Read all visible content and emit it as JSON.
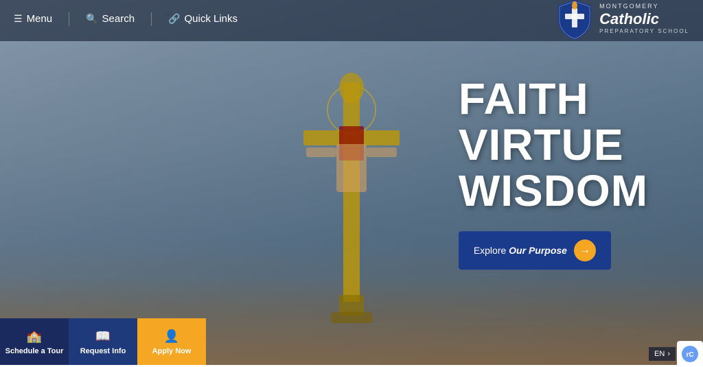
{
  "nav": {
    "menu_label": "Menu",
    "search_label": "Search",
    "quicklinks_label": "Quick Links",
    "logo_montgomery": "MONTGOMERY",
    "logo_catholic": "Catholic",
    "logo_prep": "PREPARATORY SCHOOL"
  },
  "hero": {
    "line1": "FAITH",
    "line2": "VIRTUE",
    "line3": "WISDOM",
    "cta_label": "Explore ",
    "cta_emphasis": "Our Purpose",
    "cta_arrow": "→"
  },
  "actions": [
    {
      "id": "schedule-tour",
      "label": "Schedule a Tour",
      "icon": "🏫"
    },
    {
      "id": "request-info",
      "label": "Request Info",
      "icon": "📖"
    },
    {
      "id": "apply-now",
      "label": "Apply Now",
      "icon": "👤"
    }
  ],
  "lang": {
    "current": "EN",
    "next_arrow": "›"
  }
}
